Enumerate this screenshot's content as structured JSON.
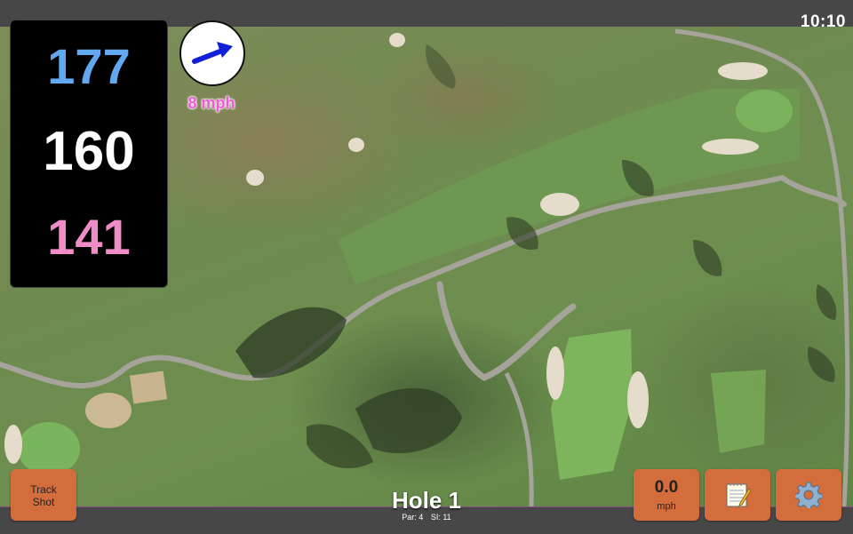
{
  "status": {
    "time": "10:10"
  },
  "yardages": {
    "back": "177",
    "middle": "160",
    "front": "141"
  },
  "wind": {
    "speed_text": "8 mph",
    "icon": "wind-direction-arrow-icon"
  },
  "hole": {
    "title": "Hole 1",
    "par": "Par: 4",
    "stroke_index": "SI: 11"
  },
  "buttons": {
    "track_shot": {
      "line1": "Track",
      "line2": "Shot"
    },
    "speed": {
      "value": "0.0",
      "unit": "mph"
    },
    "notes": {
      "icon": "notepad-icon"
    },
    "settings": {
      "icon": "gear-icon"
    }
  },
  "colors": {
    "back_yardage": "#62a8f0",
    "middle_yardage": "#ffffff",
    "front_yardage": "#f08cc6",
    "wind_text": "#f05ad6",
    "button": "#d46d3c",
    "bar": "#474747"
  }
}
